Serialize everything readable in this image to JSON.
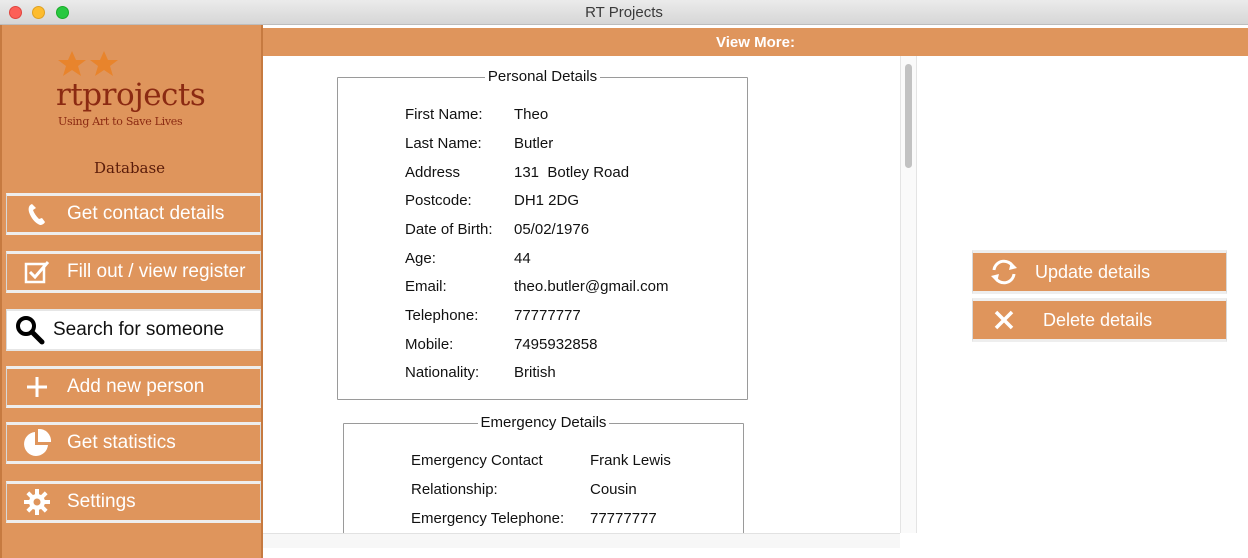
{
  "window": {
    "title": "RT Projects"
  },
  "logo": {
    "name": "rtprojects",
    "tagline": "Using Art to Save Lives",
    "subtitle": "Database"
  },
  "sidebar": {
    "items": [
      {
        "label": "Get contact details",
        "icon": "phone-icon"
      },
      {
        "label": "Fill out / view register",
        "icon": "checkbox-icon"
      },
      {
        "label": "Search for someone",
        "icon": "search-icon",
        "active": true
      },
      {
        "label": "Add new person",
        "icon": "plus-icon"
      },
      {
        "label": "Get statistics",
        "icon": "pie-chart-icon"
      },
      {
        "label": "Settings",
        "icon": "gear-icon"
      }
    ]
  },
  "header": {
    "title": "View More:"
  },
  "personal": {
    "title": "Personal Details",
    "rows": [
      {
        "label": "First Name:",
        "value": "Theo"
      },
      {
        "label": "Last Name:",
        "value": "Butler"
      },
      {
        "label": "Address",
        "value": "131  Botley Road"
      },
      {
        "label": "Postcode:",
        "value": "DH1 2DG"
      },
      {
        "label": "Date of Birth:",
        "value": "05/02/1976"
      },
      {
        "label": "Age:",
        "value": "44"
      },
      {
        "label": "Email:",
        "value": "theo.butler@gmail.com"
      },
      {
        "label": "Telephone:",
        "value": "77777777"
      },
      {
        "label": "Mobile:",
        "value": "7495932858"
      },
      {
        "label": "Nationality:",
        "value": "British"
      }
    ]
  },
  "emergency": {
    "title": "Emergency Details",
    "rows": [
      {
        "label": "Emergency Contact",
        "value": "Frank Lewis"
      },
      {
        "label": "Relationship:",
        "value": "Cousin"
      },
      {
        "label": "Emergency Telephone:",
        "value": "77777777"
      }
    ]
  },
  "actions": {
    "update_label": "Update details",
    "delete_label": "Delete details"
  },
  "colors": {
    "accent": "#df955c",
    "logo": "#8b2a12"
  }
}
